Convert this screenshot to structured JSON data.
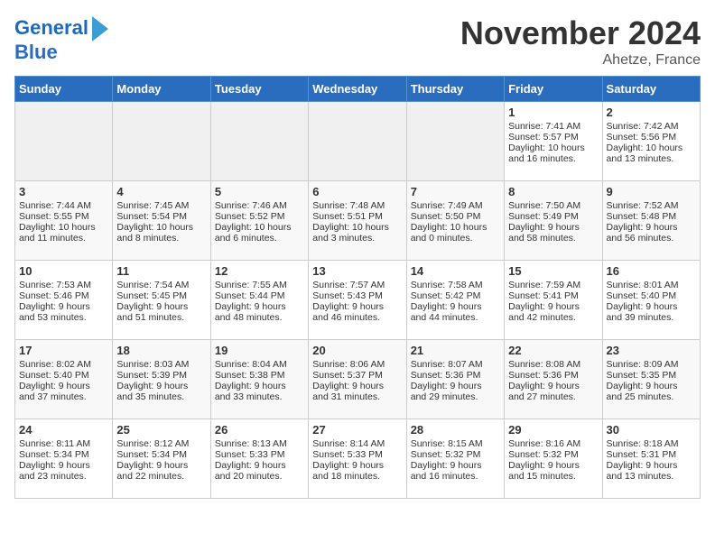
{
  "logo": {
    "line1": "General",
    "line2": "Blue"
  },
  "title": "November 2024",
  "location": "Ahetze, France",
  "days_header": [
    "Sunday",
    "Monday",
    "Tuesday",
    "Wednesday",
    "Thursday",
    "Friday",
    "Saturday"
  ],
  "weeks": [
    [
      {
        "day": "",
        "content": ""
      },
      {
        "day": "",
        "content": ""
      },
      {
        "day": "",
        "content": ""
      },
      {
        "day": "",
        "content": ""
      },
      {
        "day": "",
        "content": ""
      },
      {
        "day": "1",
        "content": "Sunrise: 7:41 AM\nSunset: 5:57 PM\nDaylight: 10 hours\nand 16 minutes."
      },
      {
        "day": "2",
        "content": "Sunrise: 7:42 AM\nSunset: 5:56 PM\nDaylight: 10 hours\nand 13 minutes."
      }
    ],
    [
      {
        "day": "3",
        "content": "Sunrise: 7:44 AM\nSunset: 5:55 PM\nDaylight: 10 hours\nand 11 minutes."
      },
      {
        "day": "4",
        "content": "Sunrise: 7:45 AM\nSunset: 5:54 PM\nDaylight: 10 hours\nand 8 minutes."
      },
      {
        "day": "5",
        "content": "Sunrise: 7:46 AM\nSunset: 5:52 PM\nDaylight: 10 hours\nand 6 minutes."
      },
      {
        "day": "6",
        "content": "Sunrise: 7:48 AM\nSunset: 5:51 PM\nDaylight: 10 hours\nand 3 minutes."
      },
      {
        "day": "7",
        "content": "Sunrise: 7:49 AM\nSunset: 5:50 PM\nDaylight: 10 hours\nand 0 minutes."
      },
      {
        "day": "8",
        "content": "Sunrise: 7:50 AM\nSunset: 5:49 PM\nDaylight: 9 hours\nand 58 minutes."
      },
      {
        "day": "9",
        "content": "Sunrise: 7:52 AM\nSunset: 5:48 PM\nDaylight: 9 hours\nand 56 minutes."
      }
    ],
    [
      {
        "day": "10",
        "content": "Sunrise: 7:53 AM\nSunset: 5:46 PM\nDaylight: 9 hours\nand 53 minutes."
      },
      {
        "day": "11",
        "content": "Sunrise: 7:54 AM\nSunset: 5:45 PM\nDaylight: 9 hours\nand 51 minutes."
      },
      {
        "day": "12",
        "content": "Sunrise: 7:55 AM\nSunset: 5:44 PM\nDaylight: 9 hours\nand 48 minutes."
      },
      {
        "day": "13",
        "content": "Sunrise: 7:57 AM\nSunset: 5:43 PM\nDaylight: 9 hours\nand 46 minutes."
      },
      {
        "day": "14",
        "content": "Sunrise: 7:58 AM\nSunset: 5:42 PM\nDaylight: 9 hours\nand 44 minutes."
      },
      {
        "day": "15",
        "content": "Sunrise: 7:59 AM\nSunset: 5:41 PM\nDaylight: 9 hours\nand 42 minutes."
      },
      {
        "day": "16",
        "content": "Sunrise: 8:01 AM\nSunset: 5:40 PM\nDaylight: 9 hours\nand 39 minutes."
      }
    ],
    [
      {
        "day": "17",
        "content": "Sunrise: 8:02 AM\nSunset: 5:40 PM\nDaylight: 9 hours\nand 37 minutes."
      },
      {
        "day": "18",
        "content": "Sunrise: 8:03 AM\nSunset: 5:39 PM\nDaylight: 9 hours\nand 35 minutes."
      },
      {
        "day": "19",
        "content": "Sunrise: 8:04 AM\nSunset: 5:38 PM\nDaylight: 9 hours\nand 33 minutes."
      },
      {
        "day": "20",
        "content": "Sunrise: 8:06 AM\nSunset: 5:37 PM\nDaylight: 9 hours\nand 31 minutes."
      },
      {
        "day": "21",
        "content": "Sunrise: 8:07 AM\nSunset: 5:36 PM\nDaylight: 9 hours\nand 29 minutes."
      },
      {
        "day": "22",
        "content": "Sunrise: 8:08 AM\nSunset: 5:36 PM\nDaylight: 9 hours\nand 27 minutes."
      },
      {
        "day": "23",
        "content": "Sunrise: 8:09 AM\nSunset: 5:35 PM\nDaylight: 9 hours\nand 25 minutes."
      }
    ],
    [
      {
        "day": "24",
        "content": "Sunrise: 8:11 AM\nSunset: 5:34 PM\nDaylight: 9 hours\nand 23 minutes."
      },
      {
        "day": "25",
        "content": "Sunrise: 8:12 AM\nSunset: 5:34 PM\nDaylight: 9 hours\nand 22 minutes."
      },
      {
        "day": "26",
        "content": "Sunrise: 8:13 AM\nSunset: 5:33 PM\nDaylight: 9 hours\nand 20 minutes."
      },
      {
        "day": "27",
        "content": "Sunrise: 8:14 AM\nSunset: 5:33 PM\nDaylight: 9 hours\nand 18 minutes."
      },
      {
        "day": "28",
        "content": "Sunrise: 8:15 AM\nSunset: 5:32 PM\nDaylight: 9 hours\nand 16 minutes."
      },
      {
        "day": "29",
        "content": "Sunrise: 8:16 AM\nSunset: 5:32 PM\nDaylight: 9 hours\nand 15 minutes."
      },
      {
        "day": "30",
        "content": "Sunrise: 8:18 AM\nSunset: 5:31 PM\nDaylight: 9 hours\nand 13 minutes."
      }
    ]
  ]
}
